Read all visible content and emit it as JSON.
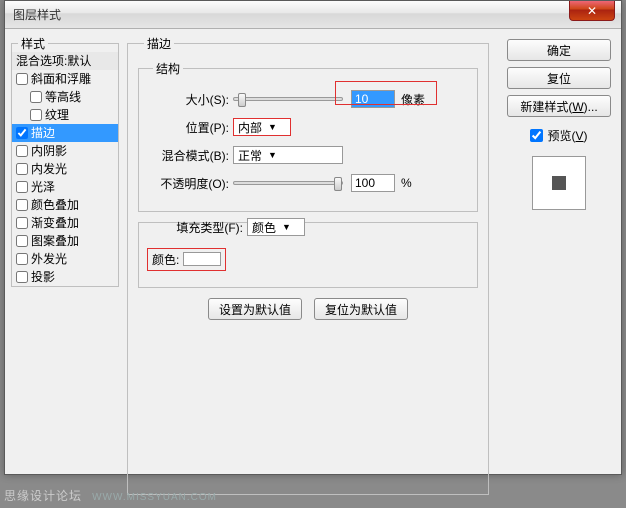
{
  "window": {
    "title": "图层样式"
  },
  "styles": {
    "legend": "样式",
    "blend": "混合选项:默认",
    "items": [
      {
        "label": "斜面和浮雕",
        "checked": false,
        "indent": 0
      },
      {
        "label": "等高线",
        "checked": false,
        "indent": 1
      },
      {
        "label": "纹理",
        "checked": false,
        "indent": 1
      },
      {
        "label": "描边",
        "checked": true,
        "indent": 0,
        "selected": true
      },
      {
        "label": "内阴影",
        "checked": false,
        "indent": 0
      },
      {
        "label": "内发光",
        "checked": false,
        "indent": 0
      },
      {
        "label": "光泽",
        "checked": false,
        "indent": 0
      },
      {
        "label": "颜色叠加",
        "checked": false,
        "indent": 0
      },
      {
        "label": "渐变叠加",
        "checked": false,
        "indent": 0
      },
      {
        "label": "图案叠加",
        "checked": false,
        "indent": 0
      },
      {
        "label": "外发光",
        "checked": false,
        "indent": 0
      },
      {
        "label": "投影",
        "checked": false,
        "indent": 0
      }
    ]
  },
  "main": {
    "legend": "描边",
    "struct_legend": "结构",
    "size": {
      "label": "大小(S):",
      "value": "10",
      "unit": "像素"
    },
    "position": {
      "label": "位置(P):",
      "value": "内部"
    },
    "blendmode": {
      "label": "混合模式(B):",
      "value": "正常"
    },
    "opacity": {
      "label": "不透明度(O):",
      "value": "100",
      "unit": "%"
    },
    "filltype": {
      "label": "填充类型(F):",
      "value": "颜色"
    },
    "color_label": "颜色:",
    "btn_default": "设置为默认值",
    "btn_reset": "复位为默认值"
  },
  "right": {
    "ok": "确定",
    "cancel": "复位",
    "newstyle": "新建样式(W)...",
    "preview": "预览(V)"
  },
  "watermark": {
    "text": "思缘设计论坛",
    "url": "WWW.MISSYUAN.COM"
  }
}
